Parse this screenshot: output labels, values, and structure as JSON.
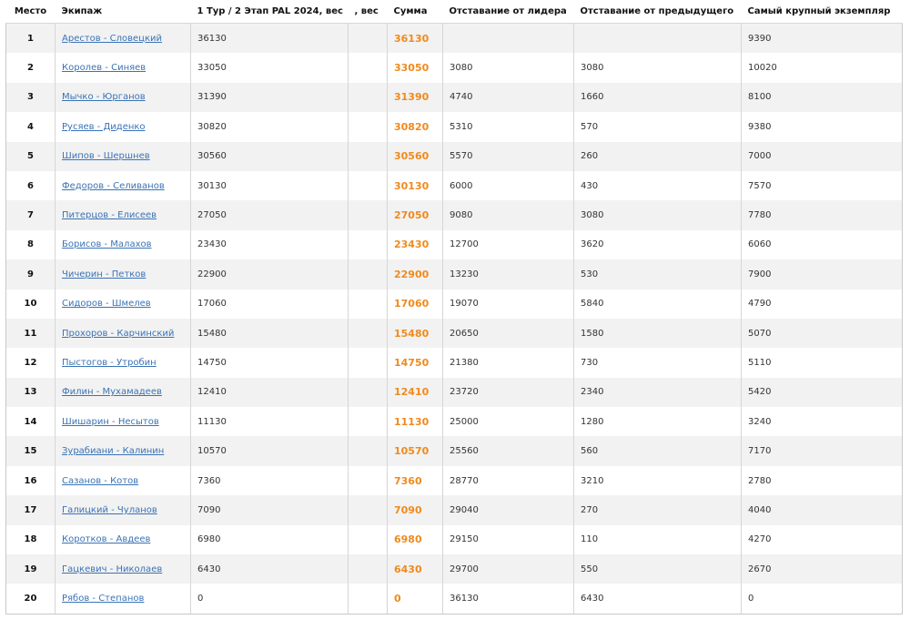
{
  "table": {
    "headers": {
      "place": "Место",
      "crew": "Экипаж",
      "stage": "1 Тур / 2 Этап PAL 2024, вес",
      "weight": ", вес",
      "sum": "Сумма",
      "gap_leader": "Отставание от лидера",
      "gap_prev": "Отставание от предыдущего",
      "biggest": "Самый крупный экземпляр"
    },
    "rows": [
      {
        "place": "1",
        "crew": "Арестов - Словецкий",
        "stage": "36130",
        "weight": "",
        "sum": "36130",
        "gap_leader": "",
        "gap_prev": "",
        "biggest": "9390"
      },
      {
        "place": "2",
        "crew": "Королев - Синяев",
        "stage": "33050",
        "weight": "",
        "sum": "33050",
        "gap_leader": "3080",
        "gap_prev": "3080",
        "biggest": "10020"
      },
      {
        "place": "3",
        "crew": "Мычко - Юрганов",
        "stage": "31390",
        "weight": "",
        "sum": "31390",
        "gap_leader": "4740",
        "gap_prev": "1660",
        "biggest": "8100"
      },
      {
        "place": "4",
        "crew": "Русяев - Диденко",
        "stage": "30820",
        "weight": "",
        "sum": "30820",
        "gap_leader": "5310",
        "gap_prev": "570",
        "biggest": "9380"
      },
      {
        "place": "5",
        "crew": "Шипов - Шершнев",
        "stage": "30560",
        "weight": "",
        "sum": "30560",
        "gap_leader": "5570",
        "gap_prev": "260",
        "biggest": "7000"
      },
      {
        "place": "6",
        "crew": "Федоров - Селиванов",
        "stage": "30130",
        "weight": "",
        "sum": "30130",
        "gap_leader": "6000",
        "gap_prev": "430",
        "biggest": "7570"
      },
      {
        "place": "7",
        "crew": "Питерцов - Елисеев",
        "stage": "27050",
        "weight": "",
        "sum": "27050",
        "gap_leader": "9080",
        "gap_prev": "3080",
        "biggest": "7780"
      },
      {
        "place": "8",
        "crew": "Борисов - Малахов",
        "stage": "23430",
        "weight": "",
        "sum": "23430",
        "gap_leader": "12700",
        "gap_prev": "3620",
        "biggest": "6060"
      },
      {
        "place": "9",
        "crew": "Чичерин - Петков",
        "stage": "22900",
        "weight": "",
        "sum": "22900",
        "gap_leader": "13230",
        "gap_prev": "530",
        "biggest": "7900"
      },
      {
        "place": "10",
        "crew": "Сидоров - Шмелев",
        "stage": "17060",
        "weight": "",
        "sum": "17060",
        "gap_leader": "19070",
        "gap_prev": "5840",
        "biggest": "4790"
      },
      {
        "place": "11",
        "crew": "Прохоров - Карчинский",
        "stage": "15480",
        "weight": "",
        "sum": "15480",
        "gap_leader": "20650",
        "gap_prev": "1580",
        "biggest": "5070"
      },
      {
        "place": "12",
        "crew": "Пыстогов - Утробин",
        "stage": "14750",
        "weight": "",
        "sum": "14750",
        "gap_leader": "21380",
        "gap_prev": "730",
        "biggest": "5110"
      },
      {
        "place": "13",
        "crew": "Филин - Мухамадеев",
        "stage": "12410",
        "weight": "",
        "sum": "12410",
        "gap_leader": "23720",
        "gap_prev": "2340",
        "biggest": "5420"
      },
      {
        "place": "14",
        "crew": "Шишарин - Несытов",
        "stage": "11130",
        "weight": "",
        "sum": "11130",
        "gap_leader": "25000",
        "gap_prev": "1280",
        "biggest": "3240"
      },
      {
        "place": "15",
        "crew": "Зурабиани - Калинин",
        "stage": "10570",
        "weight": "",
        "sum": "10570",
        "gap_leader": "25560",
        "gap_prev": "560",
        "biggest": "7170"
      },
      {
        "place": "16",
        "crew": "Сазанов - Котов",
        "stage": "7360",
        "weight": "",
        "sum": "7360",
        "gap_leader": "28770",
        "gap_prev": "3210",
        "biggest": "2780"
      },
      {
        "place": "17",
        "crew": "Галицкий - Чуланов",
        "stage": "7090",
        "weight": "",
        "sum": "7090",
        "gap_leader": "29040",
        "gap_prev": "270",
        "biggest": "4040"
      },
      {
        "place": "18",
        "crew": "Коротков - Авдеев",
        "stage": "6980",
        "weight": "",
        "sum": "6980",
        "gap_leader": "29150",
        "gap_prev": "110",
        "biggest": "4270"
      },
      {
        "place": "19",
        "crew": "Гацкевич - Николаев",
        "stage": "6430",
        "weight": "",
        "sum": "6430",
        "gap_leader": "29700",
        "gap_prev": "550",
        "biggest": "2670"
      },
      {
        "place": "20",
        "crew": "Рябов - Степанов",
        "stage": "0",
        "weight": "",
        "sum": "0",
        "gap_leader": "36130",
        "gap_prev": "6430",
        "biggest": "0"
      }
    ]
  },
  "colors": {
    "sum_accent": "#f08a1c",
    "link": "#3a73b5",
    "row_stripe": "#f2f2f2"
  }
}
